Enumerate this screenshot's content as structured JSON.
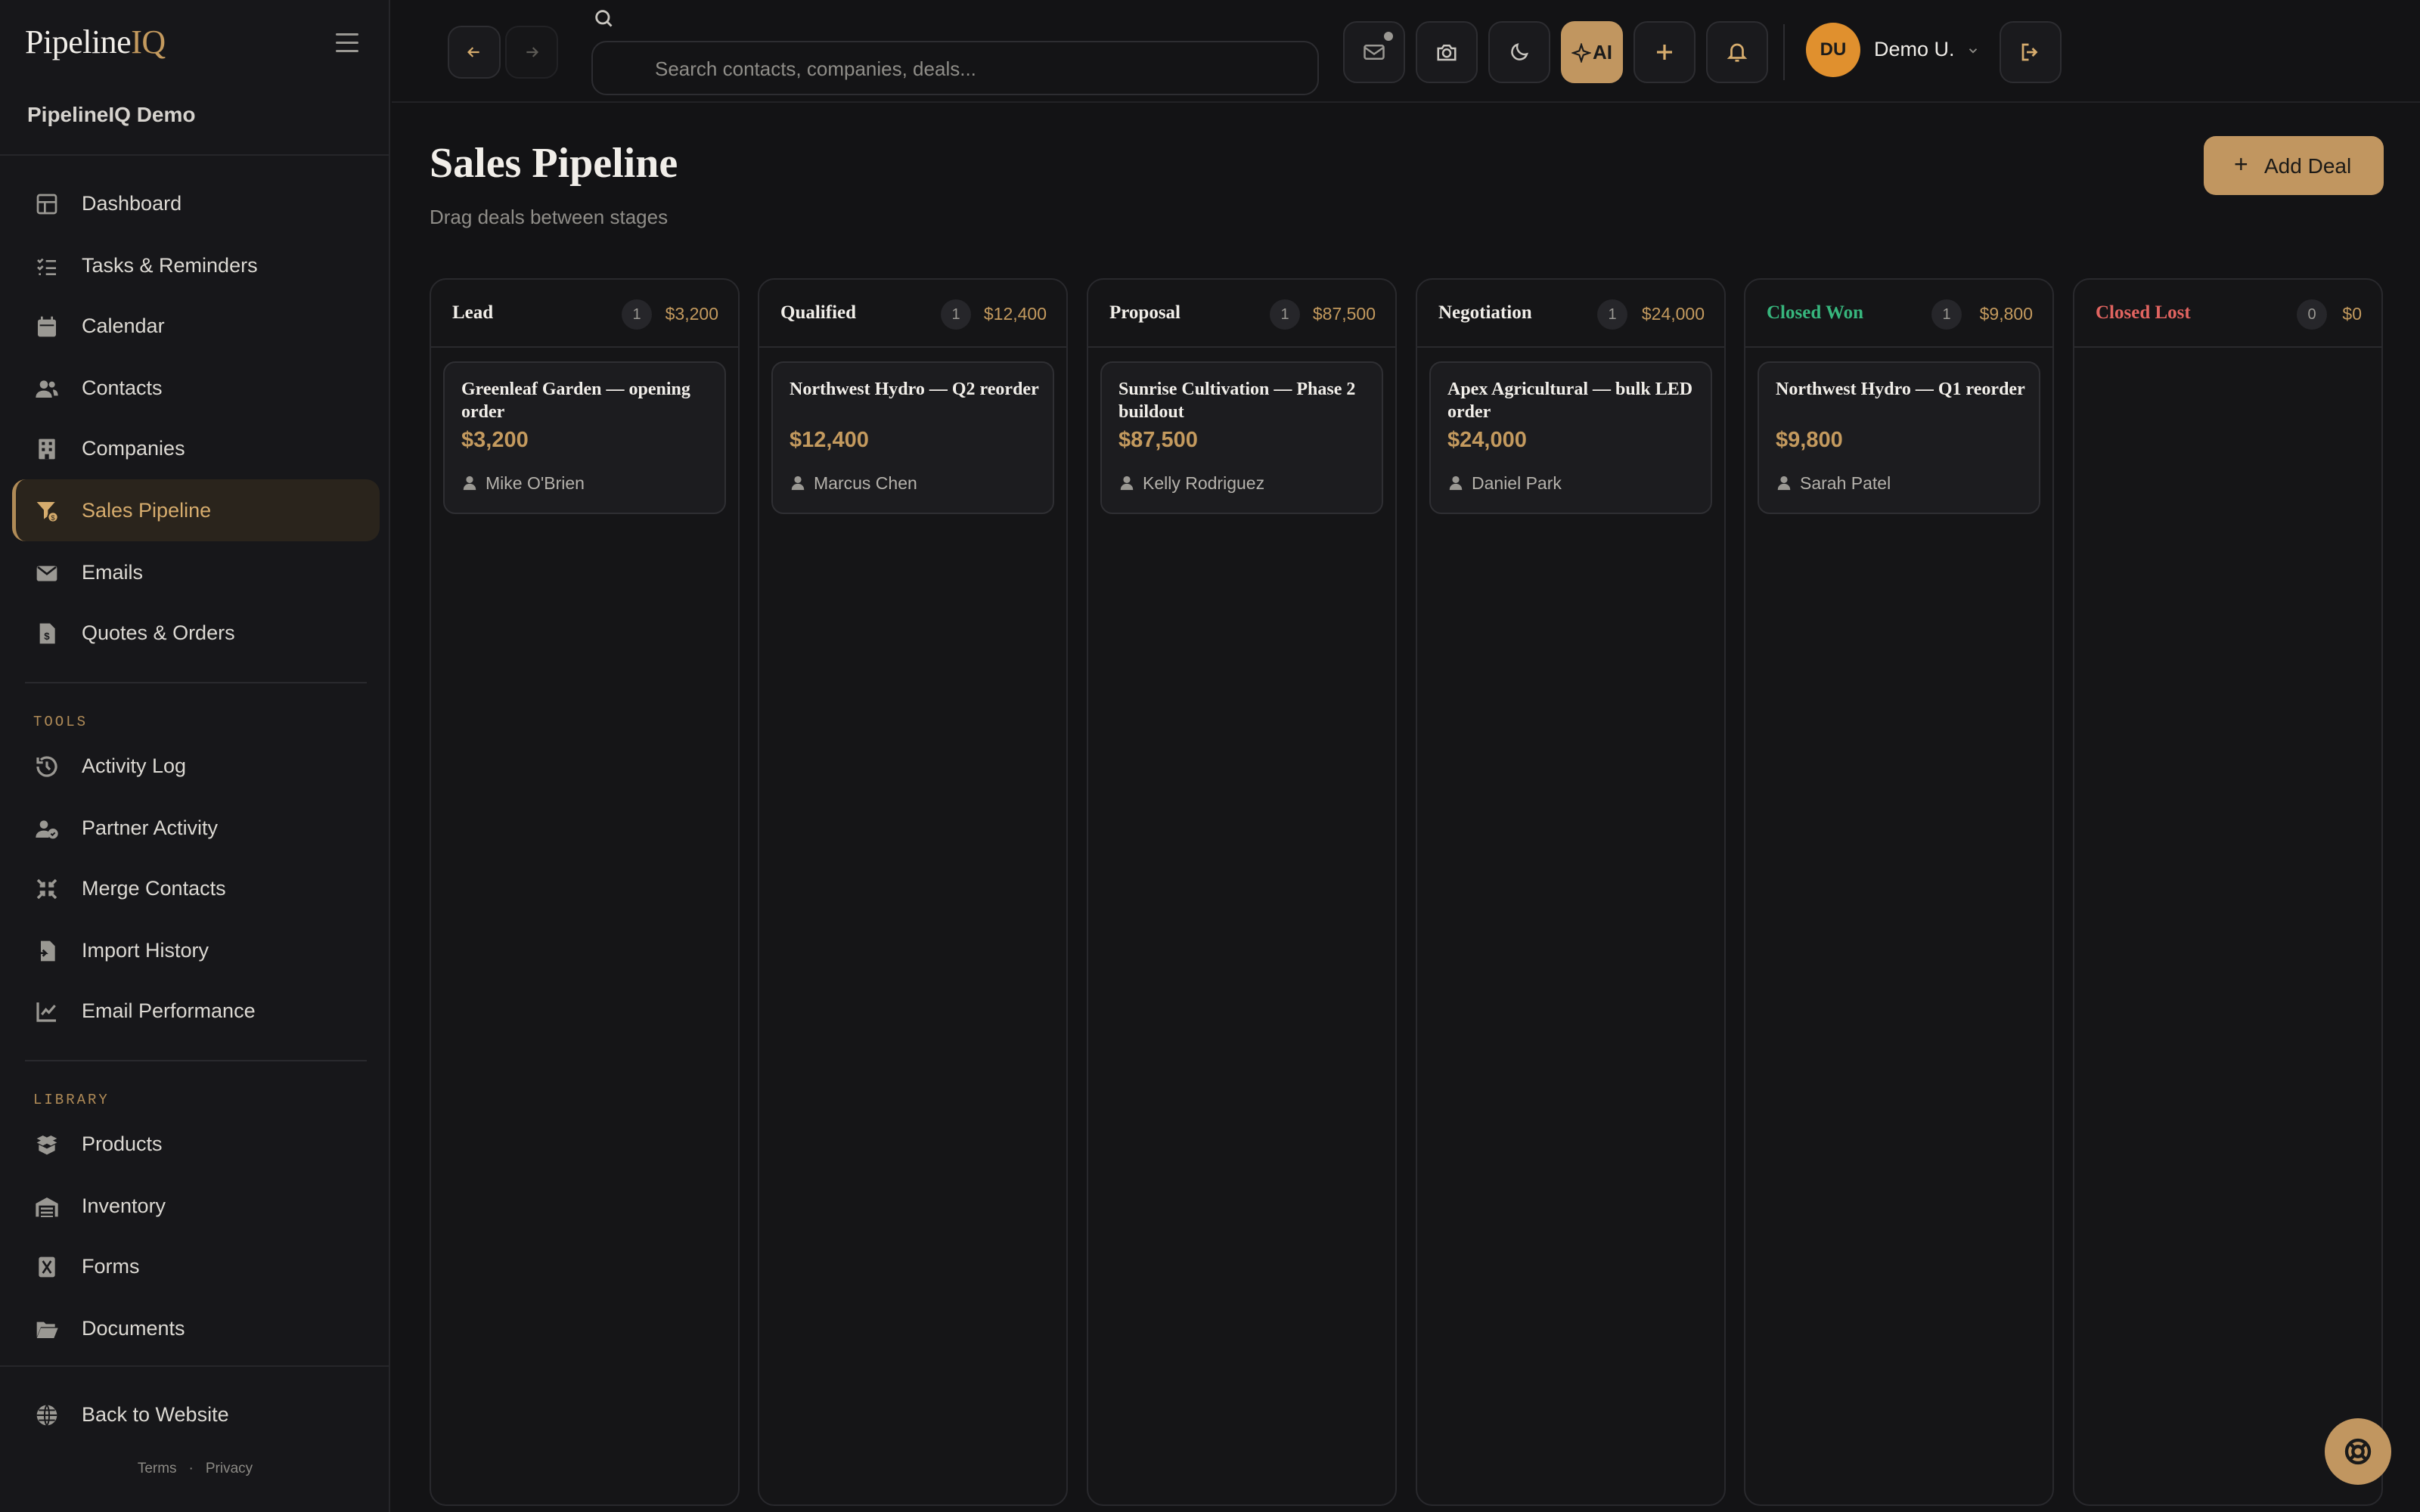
{
  "brand": {
    "name_main": "Pipeline",
    "name_accent": "IQ"
  },
  "workspace": "PipelineIQ Demo",
  "nav": {
    "main": [
      {
        "label": "Dashboard",
        "icon": "dashboard-icon"
      },
      {
        "label": "Tasks & Reminders",
        "icon": "tasks-icon"
      },
      {
        "label": "Calendar",
        "icon": "calendar-icon"
      },
      {
        "label": "Contacts",
        "icon": "contacts-icon"
      },
      {
        "label": "Companies",
        "icon": "companies-icon"
      },
      {
        "label": "Sales Pipeline",
        "icon": "pipeline-icon",
        "active": true
      },
      {
        "label": "Emails",
        "icon": "email-icon"
      },
      {
        "label": "Quotes & Orders",
        "icon": "quotes-icon"
      }
    ],
    "tools_title": "TOOLS",
    "tools": [
      {
        "label": "Activity Log",
        "icon": "history-icon"
      },
      {
        "label": "Partner Activity",
        "icon": "partner-icon"
      },
      {
        "label": "Merge Contacts",
        "icon": "merge-icon"
      },
      {
        "label": "Import History",
        "icon": "import-icon"
      },
      {
        "label": "Email Performance",
        "icon": "chart-line-icon"
      }
    ],
    "library_title": "LIBRARY",
    "library": [
      {
        "label": "Products",
        "icon": "products-icon"
      },
      {
        "label": "Inventory",
        "icon": "warehouse-icon"
      },
      {
        "label": "Forms",
        "icon": "forms-icon"
      },
      {
        "label": "Documents",
        "icon": "folder-icon"
      }
    ],
    "back": {
      "label": "Back to Website",
      "icon": "globe-icon"
    },
    "footer": {
      "terms": "Terms",
      "sep": "·",
      "privacy": "Privacy"
    }
  },
  "topbar": {
    "search_placeholder": "Search contacts, companies, deals...",
    "ai_label": "AI",
    "user_initials": "DU",
    "user_name": "Demo U."
  },
  "page": {
    "title": "Sales Pipeline",
    "subtitle": "Drag deals between stages",
    "add_button": "Add Deal"
  },
  "stages": [
    {
      "name": "Lead",
      "count": "1",
      "total": "$3,200",
      "status": "normal",
      "deals": [
        {
          "title": "Greenleaf Garden — opening order",
          "value": "$3,200",
          "contact": "Mike O'Brien"
        }
      ]
    },
    {
      "name": "Qualified",
      "count": "1",
      "total": "$12,400",
      "status": "normal",
      "deals": [
        {
          "title": "Northwest Hydro — Q2 reorder",
          "value": "$12,400",
          "contact": "Marcus Chen"
        }
      ]
    },
    {
      "name": "Proposal",
      "count": "1",
      "total": "$87,500",
      "status": "normal",
      "deals": [
        {
          "title": "Sunrise Cultivation — Phase 2 buildout",
          "value": "$87,500",
          "contact": "Kelly Rodriguez"
        }
      ]
    },
    {
      "name": "Negotiation",
      "count": "1",
      "total": "$24,000",
      "status": "normal",
      "deals": [
        {
          "title": "Apex Agricultural — bulk LED order",
          "value": "$24,000",
          "contact": "Daniel Park"
        }
      ]
    },
    {
      "name": "Closed Won",
      "count": "1",
      "total": "$9,800",
      "status": "won",
      "deals": [
        {
          "title": "Northwest Hydro — Q1 reorder",
          "value": "$9,800",
          "contact": "Sarah Patel"
        }
      ]
    },
    {
      "name": "Closed Lost",
      "count": "0",
      "total": "$0",
      "status": "lost",
      "deals": []
    }
  ],
  "colors": {
    "accent": "#c19660",
    "won": "#37b67d",
    "lost": "#e16460",
    "background": "#131315"
  }
}
